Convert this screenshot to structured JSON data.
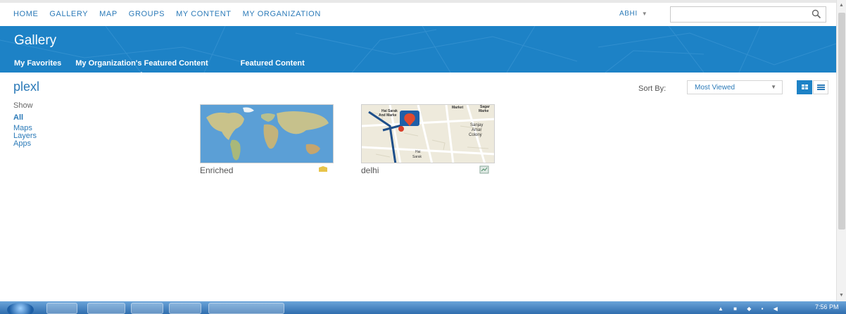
{
  "nav": {
    "links": [
      "HOME",
      "GALLERY",
      "MAP",
      "GROUPS",
      "MY CONTENT",
      "MY ORGANIZATION"
    ],
    "user": "ABHI",
    "search_placeholder": ""
  },
  "header": {
    "title": "Gallery",
    "tabs": [
      "My Favorites",
      "My Organization's Featured Content",
      "Featured Content"
    ],
    "active_tab": "My Organization's Featured Content"
  },
  "gallery": {
    "owner": "plexl",
    "sort_label": "Sort By:",
    "sort_value": "Most Viewed",
    "filter": {
      "show_label": "Show",
      "items": [
        "All",
        "Maps",
        "Layers",
        "Apps"
      ],
      "selected": "All"
    },
    "items": [
      {
        "name": "Enriched",
        "type_icon": "layer-icon"
      },
      {
        "name": "delhi",
        "type_icon": "web-map-icon"
      }
    ],
    "map_labels": [
      "Hai Sarak",
      "And Marke",
      "Market",
      "Sagar",
      "Marke",
      "Sanjay",
      "Amar",
      "Colony",
      "Hai",
      "Sarak"
    ]
  },
  "taskbar": {
    "clock": "7:56 PM"
  },
  "colors": {
    "accent": "#1d82c6",
    "link": "#2b7ab8"
  }
}
